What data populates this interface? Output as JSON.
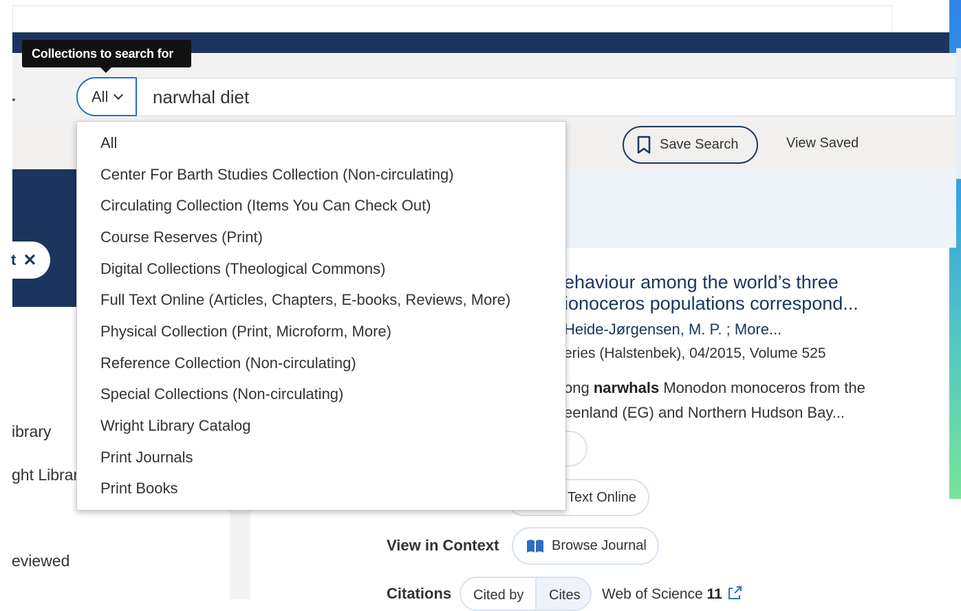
{
  "tooltip": "Collections to search for",
  "search": {
    "scope_selected": "All",
    "query": "narwhal diet"
  },
  "dropdown": {
    "options": [
      "All",
      "Center For Barth Studies Collection (Non-circulating)",
      "Circulating Collection (Items You Can Check Out)",
      "Course Reserves (Print)",
      "Digital Collections (Theological Commons)",
      "Full Text Online (Articles, Chapters, E-books, Reviews, More)",
      "Physical Collection (Print, Microform, More)",
      "Reference Collection (Non-circulating)",
      "Special Collections (Non-circulating)",
      "Wright Library Catalog",
      "Print Journals",
      "Print Books"
    ]
  },
  "toolbar": {
    "save_search": "Save Search",
    "view_saved": "View Saved"
  },
  "filter_chip": {
    "label": "t",
    "remove": "✕"
  },
  "left_items": [
    "ibrary",
    "ght Librar",
    "eviewed"
  ],
  "result": {
    "title_line1": "ehaviour among the world’s three",
    "title_line2": "ionoceros populations correspond...",
    "authors_prefix": "",
    "author_link": "Heide-Jørgensen, M. P.",
    "authors_sep": " ; ",
    "more_link": "More...",
    "publication": "eries (Halstenbek), 04/2015, Volume 525",
    "snippet_pre": "ong ",
    "snippet_bold": "narwhals",
    "snippet_post": " Monodon monoceros from the",
    "snippet_line2": "eenland (EG) and Northern Hudson Bay...",
    "full_text": "Text Online",
    "view_in_context_label": "View in Context",
    "browse_journal": "Browse Journal",
    "citations_label": "Citations",
    "cited_by": "Cited by",
    "cites": "Cites",
    "wos_label": "Web of Science",
    "wos_count": "11"
  }
}
